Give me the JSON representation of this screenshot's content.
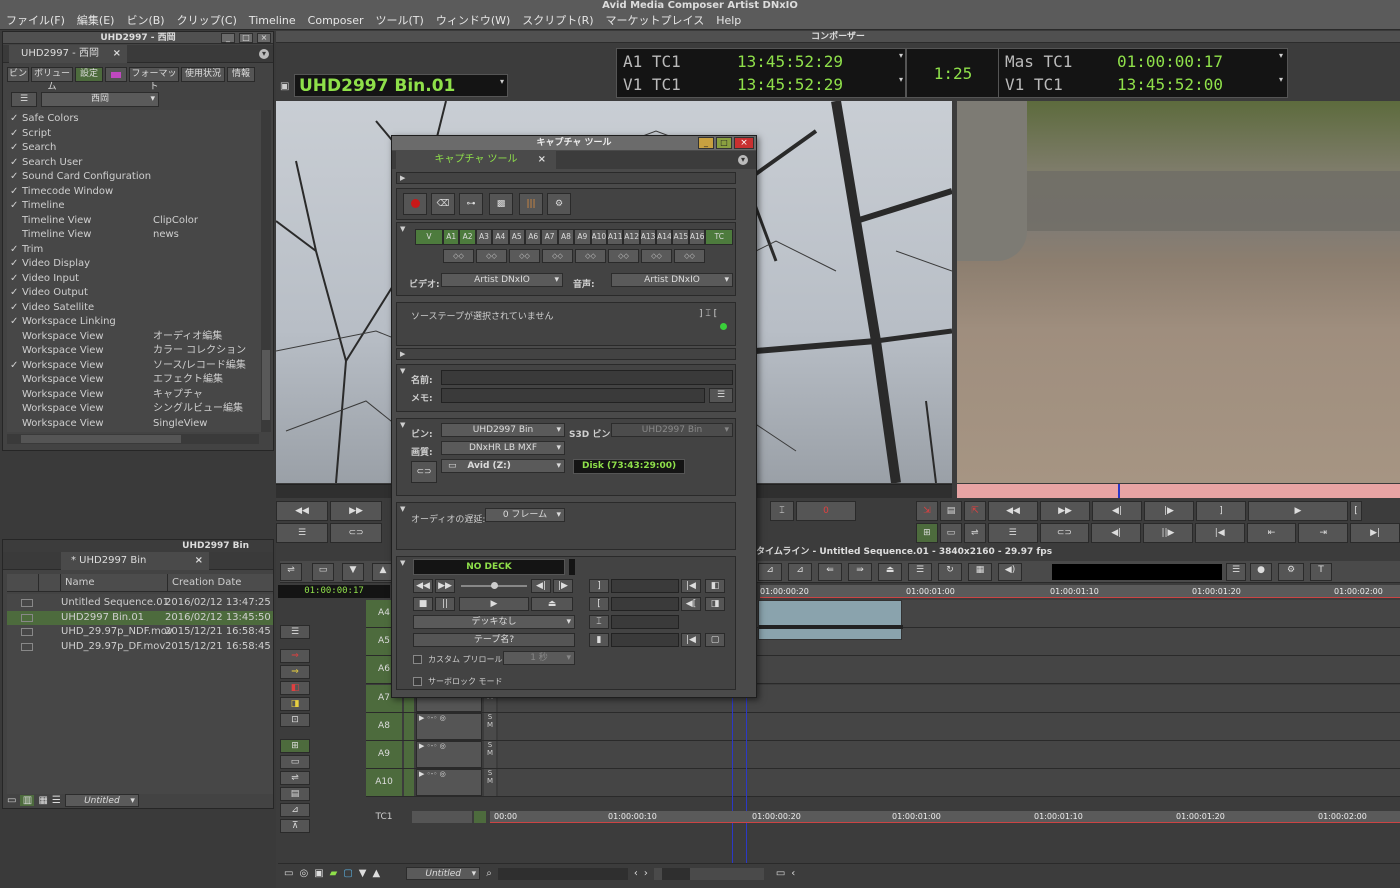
{
  "app": {
    "title": "Avid Media Composer Artist DNxIO"
  },
  "menu": [
    "ファイル(F)",
    "編集(E)",
    "ビン(B)",
    "クリップ(C)",
    "Timeline",
    "Composer",
    "ツール(T)",
    "ウィンドウ(W)",
    "スクリプト(R)",
    "マーケットプレイス",
    "Help"
  ],
  "settings": {
    "window_title": "UHD2997 - 西岡",
    "tab_label": "UHD2997 - 西岡",
    "tabs": [
      "ビン",
      "ボリューム",
      "設定",
      "",
      "フォーマット",
      "使用状況",
      "情報"
    ],
    "filter": "西岡",
    "items": [
      {
        "check": "✓",
        "name": "Safe Colors",
        "value": ""
      },
      {
        "check": "✓",
        "name": "Script",
        "value": ""
      },
      {
        "check": "✓",
        "name": "Search",
        "value": ""
      },
      {
        "check": "✓",
        "name": "Search User",
        "value": ""
      },
      {
        "check": "✓",
        "name": "Sound Card Configuration",
        "value": ""
      },
      {
        "check": "✓",
        "name": "Timecode Window",
        "value": ""
      },
      {
        "check": "✓",
        "name": "Timeline",
        "value": ""
      },
      {
        "check": "",
        "name": "Timeline View",
        "value": "ClipColor"
      },
      {
        "check": "",
        "name": "Timeline View",
        "value": "news"
      },
      {
        "check": "✓",
        "name": "Trim",
        "value": ""
      },
      {
        "check": "✓",
        "name": "Video Display",
        "value": ""
      },
      {
        "check": "✓",
        "name": "Video Input",
        "value": ""
      },
      {
        "check": "✓",
        "name": "Video Output",
        "value": ""
      },
      {
        "check": "✓",
        "name": "Video Satellite",
        "value": ""
      },
      {
        "check": "✓",
        "name": "Workspace Linking",
        "value": ""
      },
      {
        "check": "",
        "name": "Workspace View",
        "value": "オーディオ編集"
      },
      {
        "check": "",
        "name": "Workspace View",
        "value": "カラー コレクション"
      },
      {
        "check": "✓",
        "name": "Workspace View",
        "value": "ソース/レコード編集"
      },
      {
        "check": "",
        "name": "Workspace View",
        "value": "エフェクト編集"
      },
      {
        "check": "",
        "name": "Workspace View",
        "value": "キャプチャ"
      },
      {
        "check": "",
        "name": "Workspace View",
        "value": "シングルビュー編集"
      },
      {
        "check": "",
        "name": "Workspace View",
        "value": "SingleView"
      }
    ]
  },
  "bin": {
    "window_title": "UHD2997 Bin",
    "tab_label": "* UHD2997 Bin",
    "columns": [
      "Name",
      "Creation Date"
    ],
    "rows": [
      {
        "name": "Untitled Sequence.01",
        "date": "2016/02/12 13:47:25"
      },
      {
        "name": "UHD2997 Bin.01",
        "date": "2016/02/12 13:45:50"
      },
      {
        "name": "UHD_29.97p_NDF.mov",
        "date": "2015/12/21 16:58:45"
      },
      {
        "name": "UHD_29.97p_DF.mov",
        "date": "2015/12/21 16:58:45"
      }
    ],
    "view_label": "Untitled"
  },
  "composer": {
    "window_title": "コンポーザー",
    "source_name": "UHD2997 Bin.01",
    "tc": {
      "a1_label": "A1 TC1",
      "a1_value": "13:45:52:29",
      "v1_label": "V1 TC1",
      "v1_value": "13:45:52:29",
      "center": "1:25",
      "mas_label": "Mas TC1",
      "mas_value": "01:00:00:17",
      "v1r_label": "V1 TC1",
      "v1r_value": "13:45:52:00"
    },
    "mark_count": "0"
  },
  "capture": {
    "window_title": "キャプチャ ツール",
    "tab_label": "キャプチャ ツール",
    "channels": [
      "V",
      "A1",
      "A2",
      "A3",
      "A4",
      "A5",
      "A6",
      "A7",
      "A8",
      "A9",
      "A10",
      "A11",
      "A12",
      "A13",
      "A14",
      "A15",
      "A16",
      "TC"
    ],
    "pair_value": "◇◇",
    "video_label": "ビデオ:",
    "video_value": "Artist DNxIO",
    "audio_label": "音声:",
    "audio_value": "Artist DNxIO",
    "tape_status": "ソーステープが選択されていません",
    "name_label": "名前:",
    "memo_label": "メモ:",
    "bin_label": "ビン:",
    "bin_value": "UHD2997 Bin",
    "s3d_label": "S3D ビン:",
    "s3d_value": "UHD2997 Bin",
    "quality_label": "画質:",
    "quality_value": "DNxHR LB MXF",
    "drive_value": "Avid (Z:)",
    "disk_value": "Disk (73:43:29:00)",
    "delay_label": "オーディオの遅延:",
    "delay_value": "0 フレーム",
    "deck_status": "NO DECK",
    "deck_select": "デッキなし",
    "tape_name_btn": "テープ名?",
    "custom_preroll": "カスタム プリロール",
    "preroll_value": "1 秒",
    "servo_lock": "サーボロック モード"
  },
  "timeline": {
    "title": "タイムライン - Untitled Sequence.01 - 3840x2160 - 29.97 fps",
    "tc": "01:00:00:17",
    "ruler": [
      "01:00:00:20",
      "01:00:01:00",
      "01:00:01:10",
      "01:00:01:20",
      "01:00:02:00"
    ],
    "bottom_ruler": [
      "00:00",
      "01:00:00:10",
      "01:00:00:20",
      "01:00:01:00",
      "01:00:01:10",
      "01:00:01:20",
      "01:00:02:00"
    ],
    "tracks": [
      "A4",
      "A5",
      "A6",
      "A7",
      "A8",
      "A9",
      "A10"
    ],
    "tc_track": "TC1",
    "view_label": "Untitled"
  }
}
